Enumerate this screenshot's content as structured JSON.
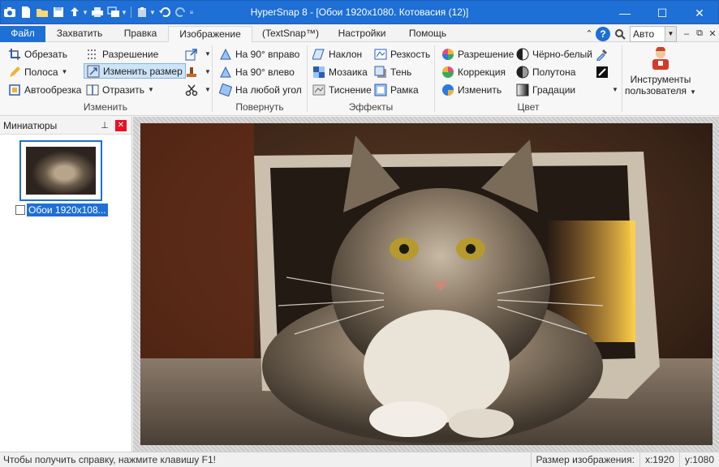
{
  "window": {
    "title": "HyperSnap 8 - [Обои 1920x1080. Котовасия  (12)]",
    "controls": {
      "minimize": "—",
      "maximize": "☐",
      "close": "✕"
    }
  },
  "tabs": [
    {
      "label": "Файл"
    },
    {
      "label": "Захватить"
    },
    {
      "label": "Правка"
    },
    {
      "label": "Изображение"
    },
    {
      "label": "(TextSnap™)"
    },
    {
      "label": "Настройки"
    },
    {
      "label": "Помощь"
    }
  ],
  "zoom": {
    "value": "Авто"
  },
  "ribbon": {
    "edit": {
      "crop": "Обрезать",
      "strip": "Полоса",
      "autocrop": "Автообрезка",
      "resolution": "Разрешение",
      "resize": "Изменить размер",
      "mirror": "Отразить",
      "group_label": "Изменить"
    },
    "rotate": {
      "right90": "На 90° вправо",
      "left90": "На 90° влево",
      "any": "На любой угол",
      "group_label": "Повернуть"
    },
    "effects": {
      "tilt": "Наклон",
      "mosaic": "Мозаика",
      "emboss": "Тиснение",
      "sharpness": "Резкость",
      "shadow": "Тень",
      "frame": "Рамка",
      "group_label": "Эффекты"
    },
    "color": {
      "resolution": "Разрешение",
      "correction": "Коррекция",
      "change": "Изменить",
      "bw": "Чёрно-белый",
      "halftone": "Полутона",
      "gradations": "Градации",
      "group_label": "Цвет"
    },
    "user_tools": {
      "line1": "Инструменты",
      "line2": "пользователя"
    }
  },
  "thumbnails": {
    "title": "Миниатюры",
    "items": [
      {
        "caption": "Обои 1920x108..."
      }
    ]
  },
  "status": {
    "message": "Чтобы получить справку, нажмите клавишу F1!",
    "size_label": "Размер изображения:",
    "x": "x:1920",
    "y": "y:1080"
  },
  "colors": {
    "accent": "#1e6fd6",
    "close": "#e81123"
  }
}
